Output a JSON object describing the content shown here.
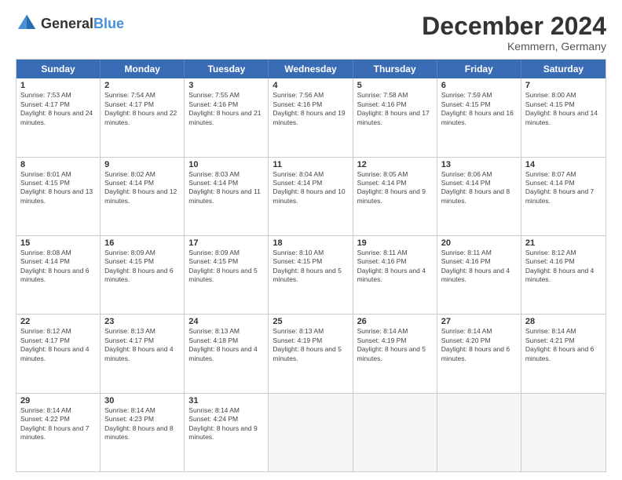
{
  "header": {
    "logo_general": "General",
    "logo_blue": "Blue",
    "month_title": "December 2024",
    "location": "Kemmern, Germany"
  },
  "days_of_week": [
    "Sunday",
    "Monday",
    "Tuesday",
    "Wednesday",
    "Thursday",
    "Friday",
    "Saturday"
  ],
  "weeks": [
    [
      {
        "day": "1",
        "sunrise": "7:53 AM",
        "sunset": "4:17 PM",
        "daylight": "8 hours and 24 minutes."
      },
      {
        "day": "2",
        "sunrise": "7:54 AM",
        "sunset": "4:17 PM",
        "daylight": "8 hours and 22 minutes."
      },
      {
        "day": "3",
        "sunrise": "7:55 AM",
        "sunset": "4:16 PM",
        "daylight": "8 hours and 21 minutes."
      },
      {
        "day": "4",
        "sunrise": "7:56 AM",
        "sunset": "4:16 PM",
        "daylight": "8 hours and 19 minutes."
      },
      {
        "day": "5",
        "sunrise": "7:58 AM",
        "sunset": "4:16 PM",
        "daylight": "8 hours and 17 minutes."
      },
      {
        "day": "6",
        "sunrise": "7:59 AM",
        "sunset": "4:15 PM",
        "daylight": "8 hours and 16 minutes."
      },
      {
        "day": "7",
        "sunrise": "8:00 AM",
        "sunset": "4:15 PM",
        "daylight": "8 hours and 14 minutes."
      }
    ],
    [
      {
        "day": "8",
        "sunrise": "8:01 AM",
        "sunset": "4:15 PM",
        "daylight": "8 hours and 13 minutes."
      },
      {
        "day": "9",
        "sunrise": "8:02 AM",
        "sunset": "4:14 PM",
        "daylight": "8 hours and 12 minutes."
      },
      {
        "day": "10",
        "sunrise": "8:03 AM",
        "sunset": "4:14 PM",
        "daylight": "8 hours and 11 minutes."
      },
      {
        "day": "11",
        "sunrise": "8:04 AM",
        "sunset": "4:14 PM",
        "daylight": "8 hours and 10 minutes."
      },
      {
        "day": "12",
        "sunrise": "8:05 AM",
        "sunset": "4:14 PM",
        "daylight": "8 hours and 9 minutes."
      },
      {
        "day": "13",
        "sunrise": "8:06 AM",
        "sunset": "4:14 PM",
        "daylight": "8 hours and 8 minutes."
      },
      {
        "day": "14",
        "sunrise": "8:07 AM",
        "sunset": "4:14 PM",
        "daylight": "8 hours and 7 minutes."
      }
    ],
    [
      {
        "day": "15",
        "sunrise": "8:08 AM",
        "sunset": "4:14 PM",
        "daylight": "8 hours and 6 minutes."
      },
      {
        "day": "16",
        "sunrise": "8:09 AM",
        "sunset": "4:15 PM",
        "daylight": "8 hours and 6 minutes."
      },
      {
        "day": "17",
        "sunrise": "8:09 AM",
        "sunset": "4:15 PM",
        "daylight": "8 hours and 5 minutes."
      },
      {
        "day": "18",
        "sunrise": "8:10 AM",
        "sunset": "4:15 PM",
        "daylight": "8 hours and 5 minutes."
      },
      {
        "day": "19",
        "sunrise": "8:11 AM",
        "sunset": "4:16 PM",
        "daylight": "8 hours and 4 minutes."
      },
      {
        "day": "20",
        "sunrise": "8:11 AM",
        "sunset": "4:16 PM",
        "daylight": "8 hours and 4 minutes."
      },
      {
        "day": "21",
        "sunrise": "8:12 AM",
        "sunset": "4:16 PM",
        "daylight": "8 hours and 4 minutes."
      }
    ],
    [
      {
        "day": "22",
        "sunrise": "8:12 AM",
        "sunset": "4:17 PM",
        "daylight": "8 hours and 4 minutes."
      },
      {
        "day": "23",
        "sunrise": "8:13 AM",
        "sunset": "4:17 PM",
        "daylight": "8 hours and 4 minutes."
      },
      {
        "day": "24",
        "sunrise": "8:13 AM",
        "sunset": "4:18 PM",
        "daylight": "8 hours and 4 minutes."
      },
      {
        "day": "25",
        "sunrise": "8:13 AM",
        "sunset": "4:19 PM",
        "daylight": "8 hours and 5 minutes."
      },
      {
        "day": "26",
        "sunrise": "8:14 AM",
        "sunset": "4:19 PM",
        "daylight": "8 hours and 5 minutes."
      },
      {
        "day": "27",
        "sunrise": "8:14 AM",
        "sunset": "4:20 PM",
        "daylight": "8 hours and 6 minutes."
      },
      {
        "day": "28",
        "sunrise": "8:14 AM",
        "sunset": "4:21 PM",
        "daylight": "8 hours and 6 minutes."
      }
    ],
    [
      {
        "day": "29",
        "sunrise": "8:14 AM",
        "sunset": "4:22 PM",
        "daylight": "8 hours and 7 minutes."
      },
      {
        "day": "30",
        "sunrise": "8:14 AM",
        "sunset": "4:23 PM",
        "daylight": "8 hours and 8 minutes."
      },
      {
        "day": "31",
        "sunrise": "8:14 AM",
        "sunset": "4:24 PM",
        "daylight": "8 hours and 9 minutes."
      },
      null,
      null,
      null,
      null
    ]
  ]
}
